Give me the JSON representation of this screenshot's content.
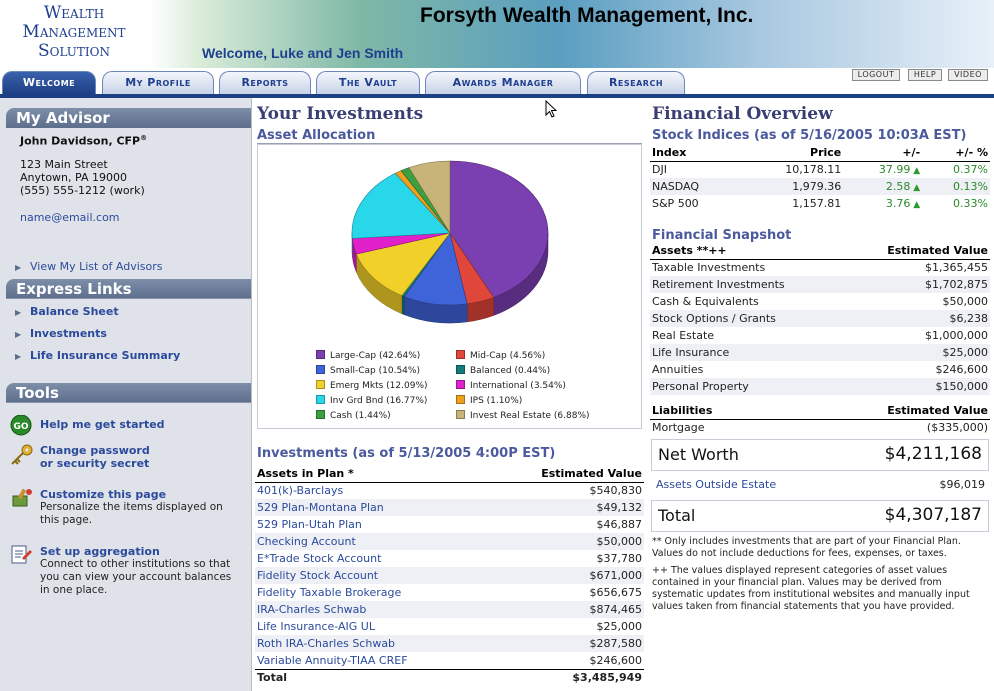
{
  "header": {
    "logo_lines": [
      "Wealth",
      "Management",
      "Solution"
    ],
    "company": "Forsyth Wealth Management, Inc.",
    "welcome": "Welcome, Luke and Jen Smith"
  },
  "nav": {
    "tabs": [
      "Welcome",
      "My Profile",
      "Reports",
      "The Vault",
      "Awards Manager",
      "Research"
    ],
    "active": "Welcome",
    "utility": [
      "LOGOUT",
      "HELP",
      "VIDEO"
    ]
  },
  "sidebar": {
    "advisor_heading": "My Advisor",
    "advisor_name": "John Davidson, CFP",
    "advisor_mark": "®",
    "address_1": "123 Main Street",
    "address_2": "Anytown, PA 19000",
    "phone": "(555) 555-1212 (work)",
    "email": "name@email.com",
    "view_advisors": "View My List of Advisors",
    "express_heading": "Express Links",
    "express_links": [
      "Balance Sheet",
      "Investments",
      "Life Insurance Summary"
    ],
    "tools_heading": "Tools",
    "tools": [
      {
        "title": "Help me get started",
        "desc": "",
        "icon": "go-icon"
      },
      {
        "title": "Change password\nor security secret",
        "desc": "",
        "icon": "key-icon"
      },
      {
        "title": "Customize this page",
        "desc": "Personalize the items displayed on this page.",
        "icon": "customize-icon"
      },
      {
        "title": "Set up aggregation",
        "desc": "Connect to other institutions so that you can view your account balances in one place.",
        "icon": "aggregation-icon"
      }
    ]
  },
  "investments": {
    "title": "Your Investments",
    "allocation_title": "Asset Allocation",
    "table_title": "Investments (as of 5/13/2005 4:00P EST)",
    "col_asset": "Assets in Plan *",
    "col_value": "Estimated Value",
    "rows": [
      {
        "name": "401(k)-Barclays",
        "value": "$540,830"
      },
      {
        "name": "529 Plan-Montana Plan",
        "value": "$49,132"
      },
      {
        "name": "529 Plan-Utah Plan",
        "value": "$46,887"
      },
      {
        "name": "Checking Account",
        "value": "$50,000"
      },
      {
        "name": "E*Trade Stock Account",
        "value": "$37,780"
      },
      {
        "name": "Fidelity Stock Account",
        "value": "$671,000"
      },
      {
        "name": "Fidelity Taxable Brokerage",
        "value": "$656,675"
      },
      {
        "name": "IRA-Charles Schwab",
        "value": "$874,465"
      },
      {
        "name": "Life Insurance-AIG UL",
        "value": "$25,000"
      },
      {
        "name": "Roth IRA-Charles Schwab",
        "value": "$287,580"
      },
      {
        "name": "Variable Annuity-TIAA CREF",
        "value": "$246,600"
      }
    ],
    "total_label": "Total",
    "total_value": "$3,485,949"
  },
  "chart_data": {
    "type": "pie",
    "slices": [
      {
        "label": "Large-Cap (42.64%)",
        "value": 42.64,
        "color": "#7a3fb0"
      },
      {
        "label": "Mid-Cap (4.56%)",
        "value": 4.56,
        "color": "#e0463a"
      },
      {
        "label": "Small-Cap (10.54%)",
        "value": 10.54,
        "color": "#3f63d8"
      },
      {
        "label": "Balanced (0.44%)",
        "value": 0.44,
        "color": "#157a7a"
      },
      {
        "label": "Emerg Mkts (12.09%)",
        "value": 12.09,
        "color": "#f2d02a"
      },
      {
        "label": "International (3.54%)",
        "value": 3.54,
        "color": "#e020c8"
      },
      {
        "label": "Inv Grd Bnd (16.77%)",
        "value": 16.77,
        "color": "#28d8ea"
      },
      {
        "label": "IPS (1.10%)",
        "value": 1.1,
        "color": "#f0a020"
      },
      {
        "label": "Cash (1.44%)",
        "value": 1.44,
        "color": "#3aa040"
      },
      {
        "label": "Invest Real Estate (6.88%)",
        "value": 6.88,
        "color": "#c8b478"
      }
    ]
  },
  "overview": {
    "title": "Financial Overview",
    "indices_title": "Stock Indices (as of 5/16/2005 10:03A EST)",
    "indices_cols": [
      "Index",
      "Price",
      "+/-",
      "+/- %"
    ],
    "indices": [
      {
        "name": "DJI",
        "price": "10,178.11",
        "chg": "37.99",
        "pct": "0.37%"
      },
      {
        "name": "NASDAQ",
        "price": "1,979.36",
        "chg": "2.58",
        "pct": "0.13%"
      },
      {
        "name": "S&P 500",
        "price": "1,157.81",
        "chg": "3.76",
        "pct": "0.33%"
      }
    ],
    "snapshot_title": "Financial Snapshot",
    "assets_col": "Assets **++",
    "value_col": "Estimated Value",
    "assets": [
      {
        "name": "Taxable Investments",
        "value": "$1,365,455"
      },
      {
        "name": "Retirement Investments",
        "value": "$1,702,875"
      },
      {
        "name": "Cash & Equivalents",
        "value": "$50,000"
      },
      {
        "name": "Stock Options / Grants",
        "value": "$6,238"
      },
      {
        "name": "Real Estate",
        "value": "$1,000,000"
      },
      {
        "name": "Life Insurance",
        "value": "$25,000"
      },
      {
        "name": "Annuities",
        "value": "$246,600"
      },
      {
        "name": "Personal Property",
        "value": "$150,000"
      }
    ],
    "liabilities_col": "Liabilities",
    "liabilities": [
      {
        "name": "Mortgage",
        "value": "($335,000)"
      }
    ],
    "net_worth_label": "Net Worth",
    "net_worth_value": "$4,211,168",
    "outside_label": "Assets Outside Estate",
    "outside_value": "$96,019",
    "total_label": "Total",
    "total_value": "$4,307,187",
    "note_1": "** Only includes investments that are part of your Financial Plan. Values do not include deductions for fees, expenses, or taxes.",
    "note_2": "++ The values displayed represent categories of asset values contained in your financial plan. Values may be derived from systematic updates from institutional websites and manually input values taken from financial statements that you have provided."
  }
}
